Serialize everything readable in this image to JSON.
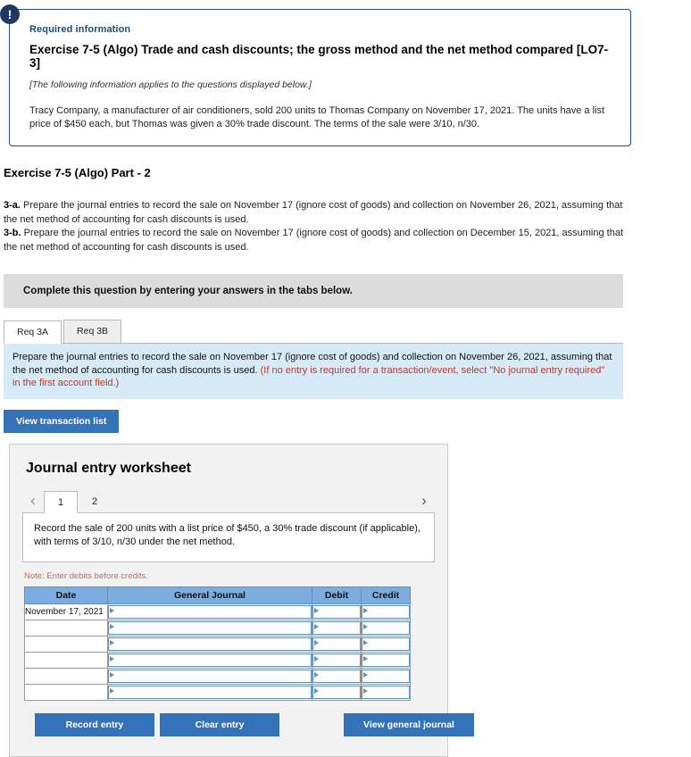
{
  "alert": {
    "icon": "exclamation-icon",
    "glyph": "!"
  },
  "required_info": {
    "label": "Required information",
    "title": "Exercise 7-5 (Algo) Trade and cash discounts; the gross method and the net method compared [LO7-3]",
    "applies_note": "[The following information applies to the questions displayed below.]",
    "body": "Tracy Company, a manufacturer of air conditioners, sold 200 units to Thomas Company on November 17, 2021. The units have a list price of $450 each, but Thomas was given a 30% trade discount. The terms of the sale were 3/10, n/30."
  },
  "part_heading": "Exercise 7-5 (Algo) Part - 2",
  "requirements": [
    {
      "label": "3-a.",
      "text": "Prepare the journal entries to record the sale on November 17 (ignore cost of goods) and collection on November 26, 2021, assuming that the net method of accounting for cash discounts is used."
    },
    {
      "label": "3-b.",
      "text": "Prepare the journal entries to record the sale on November 17 (ignore cost of goods) and collection on December 15, 2021, assuming that the net method of accounting for cash discounts is used."
    }
  ],
  "banner": "Complete this question by entering your answers in the tabs below.",
  "tabs": [
    {
      "label": "Req 3A",
      "active": true
    },
    {
      "label": "Req 3B",
      "active": false
    }
  ],
  "instruction": {
    "black_part": "Prepare the journal entries to record the sale on November 17 (ignore cost of goods) and collection on November 26, 2021, assuming that the net method of accounting for cash discounts is used. ",
    "red_part": "(If no entry is required for a transaction/event, select \"No journal entry required\" in the first account field.)"
  },
  "view_transaction_list_label": "View transaction list",
  "worksheet": {
    "title": "Journal entry worksheet",
    "prev_arrow": "‹",
    "next_arrow": "›",
    "pages": [
      {
        "label": "1",
        "active": true
      },
      {
        "label": "2",
        "active": false
      }
    ],
    "description": "Record the sale of 200 units with a list price of $450, a 30% trade discount (if applicable), with terms of 3/10, n/30 under the net method.",
    "note": "Note: Enter debits before credits.",
    "table": {
      "columns": [
        "Date",
        "General Journal",
        "Debit",
        "Credit"
      ],
      "rows": [
        {
          "date": "November 17, 2021",
          "general_journal": "",
          "debit": "",
          "credit": ""
        },
        {
          "date": "",
          "general_journal": "",
          "debit": "",
          "credit": ""
        },
        {
          "date": "",
          "general_journal": "",
          "debit": "",
          "credit": ""
        },
        {
          "date": "",
          "general_journal": "",
          "debit": "",
          "credit": ""
        },
        {
          "date": "",
          "general_journal": "",
          "debit": "",
          "credit": ""
        },
        {
          "date": "",
          "general_journal": "",
          "debit": "",
          "credit": ""
        }
      ]
    },
    "buttons": {
      "record": "Record entry",
      "clear": "Clear entry",
      "view_general_journal": "View general journal"
    }
  },
  "colors": {
    "accent_blue": "#3573b9",
    "table_header_blue": "#7cadde",
    "instruction_bg": "#d6eaf8",
    "banner_gray": "#dcdcdc",
    "navy": "#1f4e79",
    "red_note": "#c0392b"
  }
}
